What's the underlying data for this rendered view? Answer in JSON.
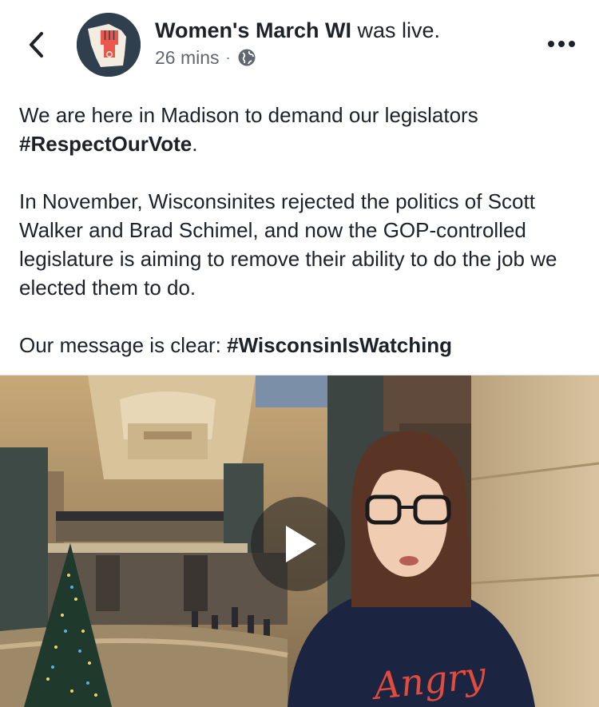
{
  "post": {
    "page_name": "Women's March WI",
    "status_suffix": "was live.",
    "time_ago": "26 mins",
    "separator": "·",
    "privacy_icon": "globe-icon",
    "text": {
      "line1_prefix": "We are here in Madison to demand our legislators",
      "hashtag1": "#RespectOurVote",
      "line1_end": ".",
      "paragraph2": "In November, Wisconsinites rejected the politics of Scott Walker and Brad Schimel, and now the GOP-controlled legislature is aiming to remove their ability to do the job we elected them to do.",
      "line3_prefix": "Our message is clear:",
      "hashtag2": "#WisconsinIsWatching"
    }
  },
  "video": {
    "play_icon": "play-icon",
    "shirt_text": "Angry"
  },
  "icons": {
    "back": "chevron-left-icon",
    "more": "more-dots-icon"
  },
  "colors": {
    "text": "#1d2129",
    "meta": "#616770",
    "avatar_bg": "#2f3f4e",
    "avatar_fist": "#e8584c"
  }
}
